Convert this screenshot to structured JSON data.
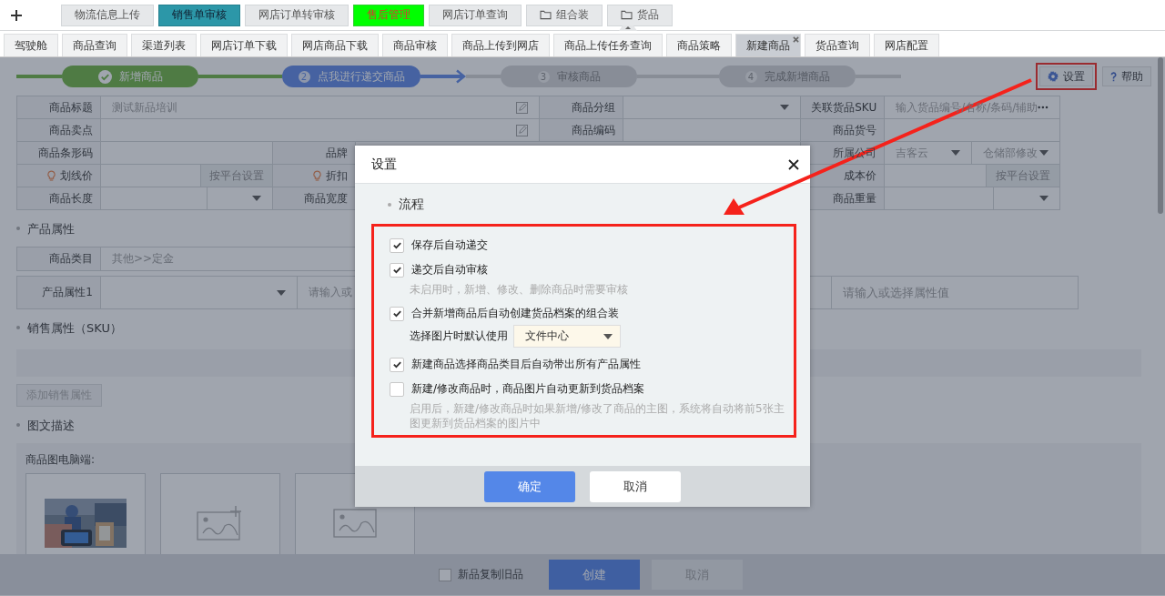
{
  "top_tabs": [
    {
      "label": "物流信息上传",
      "kind": "tab",
      "selected": false,
      "highlighted": false
    },
    {
      "label": "销售单审核",
      "kind": "tab",
      "selected": true,
      "highlighted": false
    },
    {
      "label": "网店订单转审核",
      "kind": "tab",
      "selected": false,
      "highlighted": false
    },
    {
      "label": "售后管理",
      "kind": "tab",
      "selected": false,
      "highlighted": true
    },
    {
      "label": "网店订单查询",
      "kind": "tab",
      "selected": false,
      "highlighted": false
    },
    {
      "label": "组合装",
      "kind": "folder",
      "selected": false,
      "highlighted": false
    },
    {
      "label": "货品",
      "kind": "folder",
      "selected": false,
      "highlighted": false
    }
  ],
  "page_tabs": [
    {
      "label": "驾驶舱",
      "selected": false,
      "closable": false
    },
    {
      "label": "商品查询",
      "selected": false,
      "closable": false
    },
    {
      "label": "渠道列表",
      "selected": false,
      "closable": false
    },
    {
      "label": "网店订单下载",
      "selected": false,
      "closable": false
    },
    {
      "label": "网店商品下载",
      "selected": false,
      "closable": false
    },
    {
      "label": "商品审核",
      "selected": false,
      "closable": false
    },
    {
      "label": "商品上传到网店",
      "selected": false,
      "closable": false
    },
    {
      "label": "商品上传任务查询",
      "selected": false,
      "closable": false
    },
    {
      "label": "商品策略",
      "selected": false,
      "closable": false
    },
    {
      "label": "新建商品",
      "selected": true,
      "closable": true
    },
    {
      "label": "货品查询",
      "selected": false,
      "closable": false
    },
    {
      "label": "网店配置",
      "selected": false,
      "closable": false
    }
  ],
  "steps": [
    {
      "label": "新增商品",
      "kind": "done"
    },
    {
      "label": "点我进行递交商品",
      "number": "2",
      "kind": "current"
    },
    {
      "label": "审核商品",
      "number": "3",
      "kind": "pending"
    },
    {
      "label": "完成新增商品",
      "number": "4",
      "kind": "pending"
    }
  ],
  "toolbar": {
    "settings": "设置",
    "help": "帮助"
  },
  "form": {
    "title_rows": [
      {
        "cells": [
          {
            "kind": "label",
            "text": "商品标题"
          },
          {
            "kind": "input",
            "placeholder": "测试新品培训"
          },
          {
            "kind": "label",
            "text": "商品分组"
          },
          {
            "kind": "select"
          },
          {
            "kind": "label",
            "text": "关联货品SKU"
          },
          {
            "kind": "input",
            "placeholder": "输入货品编号/名称/条码/辅助"
          }
        ]
      },
      {
        "cells": [
          {
            "kind": "label",
            "text": "商品卖点"
          },
          {
            "kind": "input"
          },
          {
            "kind": "label",
            "text": "商品编码"
          },
          {
            "kind": "input"
          },
          {
            "kind": "label",
            "text": "商品货号"
          },
          {
            "kind": "input"
          }
        ]
      }
    ],
    "detail_rows": [
      {
        "cells": [
          {
            "kind": "label",
            "text": "商品条形码"
          },
          {
            "kind": "input"
          },
          {
            "kind": "merged"
          },
          {
            "kind": "label",
            "text": "品牌"
          },
          {
            "kind": "blank"
          },
          {
            "kind": "label",
            "text": "所属公司"
          },
          {
            "kind": "select",
            "value": "吉客云"
          },
          {
            "kind": "select",
            "value": "仓储部修改"
          }
        ]
      },
      {
        "cells": [
          {
            "kind": "label",
            "text": "划线价"
          },
          {
            "kind": "input"
          },
          {
            "kind": "button",
            "text": "按平台设置"
          },
          {
            "kind": "label",
            "text": "折扣"
          },
          {
            "kind": "blank"
          },
          {
            "kind": "label",
            "text": "成本价"
          },
          {
            "kind": "input"
          },
          {
            "kind": "button",
            "text": "按平台设置"
          }
        ]
      },
      {
        "cells": [
          {
            "kind": "label",
            "text": "商品长度"
          },
          {
            "kind": "input"
          },
          {
            "kind": "select"
          },
          {
            "kind": "label",
            "text": "商品宽度"
          },
          {
            "kind": "blank"
          },
          {
            "kind": "label",
            "text": "商品重量"
          },
          {
            "kind": "input"
          },
          {
            "kind": "select"
          }
        ]
      }
    ]
  },
  "product_attributes": {
    "title": "产品属性",
    "category_label": "商品类目",
    "category_value": "其他>>定金",
    "attr_label": "产品属性1",
    "attr_placeholder": "请输入或",
    "value_placeholder": "请输入或选择属性值"
  },
  "sales_attributes": {
    "title": "销售属性（SKU）",
    "add_button": "添加销售属性"
  },
  "description": {
    "title": "图文描述",
    "images_label": "商品图电脑端:",
    "images": [
      {
        "kind": "picture"
      },
      {
        "kind": "add"
      },
      {
        "kind": "placeholder"
      }
    ]
  },
  "footer": {
    "copy_label": "新品复制旧品",
    "copy_checked": false,
    "create": "创建",
    "cancel": "取消"
  },
  "dialog": {
    "title": "设置",
    "section": "流程",
    "options": [
      {
        "label": "保存后自动递交",
        "checked": true
      },
      {
        "label": "递交后自动审核",
        "checked": true,
        "hint": "未启用时，新增、修改、删除商品时需要审核"
      },
      {
        "label": "合并新增商品后自动创建货品档案的组合装",
        "checked": true,
        "select": {
          "label": "选择图片时默认使用",
          "value": "文件中心"
        }
      },
      {
        "label": "新建商品选择商品类目后自动带出所有产品属性",
        "checked": true
      },
      {
        "label": "新建/修改商品时，商品图片自动更新到货品档案",
        "checked": false,
        "hint": "启用后，新建/修改商品时如果新增/修改了商品的主图，系统将自动将前5张主图更新到货品档案的图片中"
      }
    ],
    "ok": "确定",
    "cancel": "取消"
  }
}
